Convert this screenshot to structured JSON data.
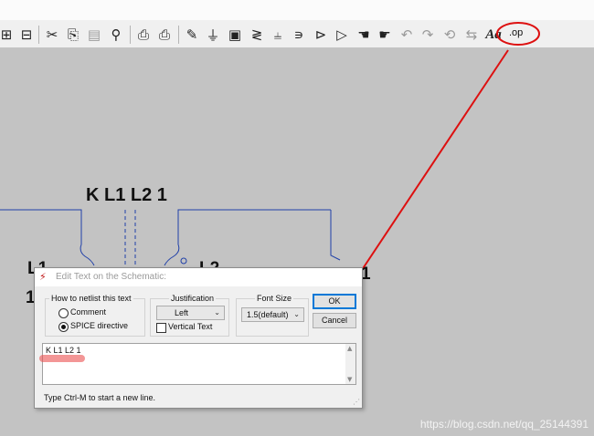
{
  "toolbar": {
    "icons": [
      "hierarchy-down-icon",
      "hierarchy-up-icon",
      "cut-icon",
      "copy-icon",
      "paste-icon",
      "find-icon",
      "print-setup-icon",
      "print-icon",
      "wire-pencil-icon",
      "ground-icon",
      "label-net-icon",
      "resistor-icon",
      "capacitor-icon",
      "inductor-icon",
      "diode-icon",
      "component-icon",
      "move-hand-icon",
      "drag-hand-icon",
      "undo-icon",
      "redo-icon",
      "rotate-icon",
      "mirror-icon",
      "text-icon"
    ],
    "op_label": ".op"
  },
  "schematic": {
    "directive_label": "K L1 L2 1",
    "left_inductor_label": "L1",
    "left_inductor_value": "1",
    "right_inductor_label": "L2",
    "right_inductor_value": "1"
  },
  "dialog": {
    "title": "Edit Text on the Schematic:",
    "netlist_group": {
      "label": "How to netlist this text",
      "options": [
        {
          "label": "Comment",
          "selected": false
        },
        {
          "label": "SPICE directive",
          "selected": true
        }
      ]
    },
    "justification": {
      "label": "Justification",
      "value": "Left",
      "vertical_text_label": "Vertical Text",
      "vertical_text_checked": false
    },
    "font_size": {
      "label": "Font Size",
      "value": "1.5(default)"
    },
    "ok_label": "OK",
    "cancel_label": "Cancel",
    "text_value": "K L1 L2 1",
    "hint": "Type Ctrl-M to start a new line."
  },
  "watermark": "https://blog.csdn.net/qq_25144391",
  "colors": {
    "annotation_red": "#dd1010",
    "wire_blue": "#1f3fa8",
    "highlight_red": "#eb5050",
    "canvas_gray": "#c3c3c3"
  }
}
